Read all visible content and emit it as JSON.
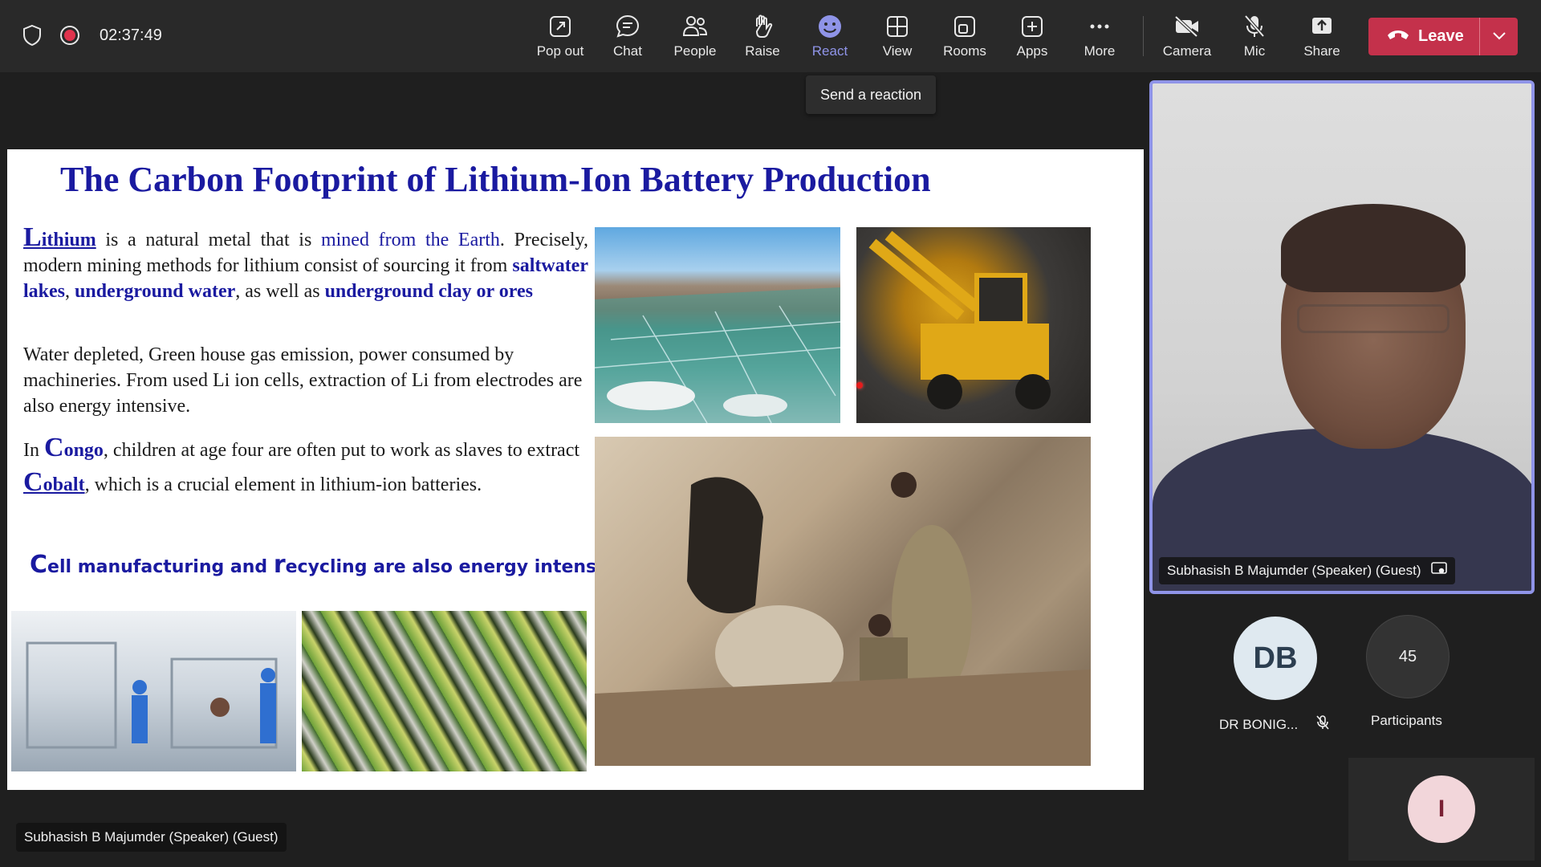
{
  "meeting": {
    "timer": "02:37:49"
  },
  "toolbar": {
    "items": [
      {
        "label": "Pop out",
        "icon": "pop-out-icon"
      },
      {
        "label": "Chat",
        "icon": "chat-icon"
      },
      {
        "label": "People",
        "icon": "people-icon"
      },
      {
        "label": "Raise",
        "icon": "raise-hand-icon"
      },
      {
        "label": "React",
        "icon": "smiley-icon"
      },
      {
        "label": "View",
        "icon": "grid-icon"
      },
      {
        "label": "Rooms",
        "icon": "rooms-icon"
      },
      {
        "label": "Apps",
        "icon": "apps-plus-icon"
      },
      {
        "label": "More",
        "icon": "more-dots-icon"
      }
    ],
    "device_items": [
      {
        "label": "Camera",
        "icon": "camera-off-icon"
      },
      {
        "label": "Mic",
        "icon": "mic-off-icon"
      },
      {
        "label": "Share",
        "icon": "share-icon"
      }
    ],
    "leave_label": "Leave",
    "tooltip": "Send a reaction",
    "accent_color": "#8f94e8",
    "leave_color": "#c4314b"
  },
  "slide": {
    "title": "The Carbon Footprint of Lithium-Ion Battery Production",
    "p1": {
      "lithium_cap": "L",
      "lithium_rest": "ithium",
      "t1": " is a natural metal that is ",
      "mined": "mined from the Earth",
      "t2": ". Precisely, modern mining methods for lithium consist of sourcing it from ",
      "salt": "saltwater lakes",
      "t3": ", ",
      "water": "underground water",
      "t4": ", as well as ",
      "clay": "underground clay or ores"
    },
    "p2": "Water depleted, Green house gas emission, power consumed by machineries. From used Li ion cells, extraction of Li from electrodes are also energy intensive.",
    "p3": {
      "t1": "In ",
      "congo_cap": "C",
      "congo_rest": "ongo",
      "t2": ", children at age four are often put to work as slaves to extract ",
      "cobalt_cap": "C",
      "cobalt_rest": "obalt",
      "t3": ", which is a crucial element in lithium-ion batteries."
    },
    "p4": {
      "c1": "C",
      "t1": "ell manufacturing and ",
      "c2": "r",
      "t2": "ecycling are also energy intensive"
    }
  },
  "speaker_tag": "Subhasish B Majumder (Speaker) (Guest)",
  "video": {
    "name": "Subhasish B Majumder (Speaker) (Guest)"
  },
  "participants": {
    "db_initials": "DB",
    "db_name": "DR BONIG...",
    "count": "45",
    "count_label": "Participants",
    "i_initial": "I"
  }
}
